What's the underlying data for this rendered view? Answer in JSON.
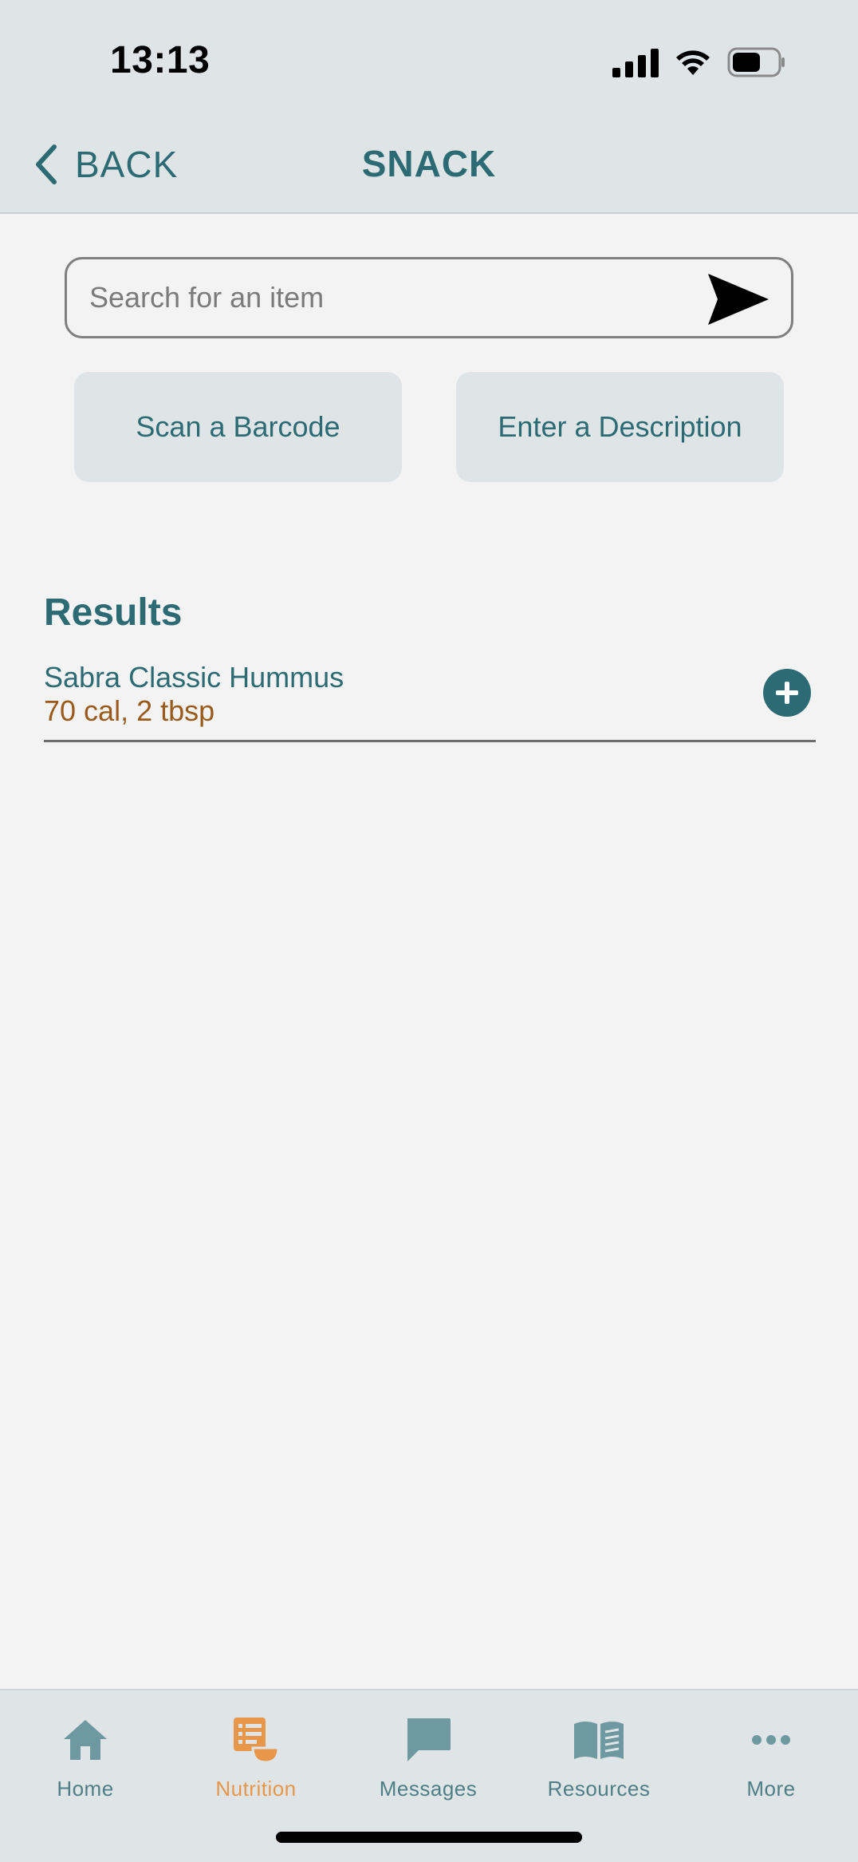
{
  "status_bar": {
    "time": "13:13"
  },
  "header": {
    "back_label": "BACK",
    "title": "SNACK"
  },
  "search": {
    "placeholder": "Search for an item",
    "value": ""
  },
  "actions": {
    "scan_label": "Scan a Barcode",
    "describe_label": "Enter a Description"
  },
  "results": {
    "heading": "Results",
    "items": [
      {
        "name": "Sabra Classic Hummus",
        "detail": "70 cal, 2 tbsp"
      }
    ]
  },
  "tabbar": {
    "active": "Nutrition",
    "tabs": [
      {
        "label": "Home",
        "icon": "home-icon"
      },
      {
        "label": "Nutrition",
        "icon": "nutrition-icon"
      },
      {
        "label": "Messages",
        "icon": "messages-icon"
      },
      {
        "label": "Resources",
        "icon": "resources-icon"
      },
      {
        "label": "More",
        "icon": "more-icon"
      }
    ]
  },
  "colors": {
    "primary": "#2c6b74",
    "accent": "#e8964a",
    "detail_text": "#9a5a1c",
    "header_bg": "#dfe5e7",
    "page_bg": "#f3f3f3"
  }
}
